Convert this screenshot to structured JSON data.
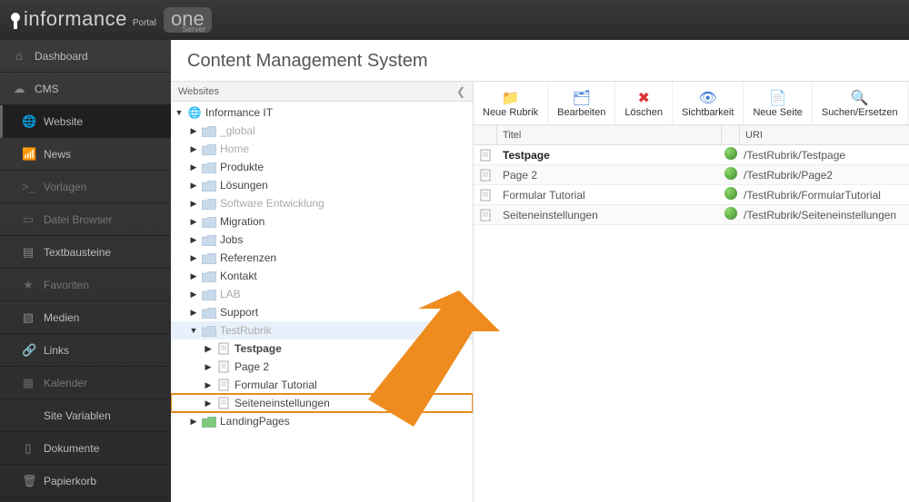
{
  "brand": {
    "name": "informance",
    "portal": "Portal",
    "one": "one",
    "server": "Server"
  },
  "sidebar": [
    {
      "icon": "home",
      "label": "Dashboard",
      "dim": false
    },
    {
      "icon": "cloud",
      "label": "CMS",
      "dim": false
    },
    {
      "icon": "globe",
      "label": "Website",
      "dim": false,
      "active": true,
      "indent": true
    },
    {
      "icon": "rss",
      "label": "News",
      "dim": false,
      "indent": true
    },
    {
      "icon": "code",
      "label": "Vorlagen",
      "dim": true,
      "indent": true
    },
    {
      "icon": "book",
      "label": "Datei Browser",
      "dim": true,
      "indent": true
    },
    {
      "icon": "text",
      "label": "Textbausteine",
      "dim": false,
      "indent": true
    },
    {
      "icon": "star",
      "label": "Favoriten",
      "dim": true,
      "indent": true
    },
    {
      "icon": "image",
      "label": "Medien",
      "dim": false,
      "indent": true
    },
    {
      "icon": "link",
      "label": "Links",
      "dim": false,
      "indent": true
    },
    {
      "icon": "cal",
      "label": "Kalender",
      "dim": true,
      "indent": true
    },
    {
      "icon": "vars",
      "label": "Site Variablen",
      "dim": false,
      "indent": true
    },
    {
      "icon": "doc",
      "label": "Dokumente",
      "dim": false,
      "indent": true
    },
    {
      "icon": "trash",
      "label": "Papierkorb",
      "dim": false,
      "indent": true
    }
  ],
  "page_title": "Content Management System",
  "tree_header": "Websites",
  "tree_root": "Informance IT",
  "tree": [
    {
      "lvl": 1,
      "type": "folder",
      "label": "_global",
      "dim": true
    },
    {
      "lvl": 1,
      "type": "folder",
      "label": "Home",
      "dim": true
    },
    {
      "lvl": 1,
      "type": "folder",
      "label": "Produkte"
    },
    {
      "lvl": 1,
      "type": "folder",
      "label": "Lösungen"
    },
    {
      "lvl": 1,
      "type": "folder",
      "label": "Software Entwicklung",
      "dim": true
    },
    {
      "lvl": 1,
      "type": "folder",
      "label": "Migration"
    },
    {
      "lvl": 1,
      "type": "folder",
      "label": "Jobs"
    },
    {
      "lvl": 1,
      "type": "folder",
      "label": "Referenzen"
    },
    {
      "lvl": 1,
      "type": "folder",
      "label": "Kontakt"
    },
    {
      "lvl": 1,
      "type": "folder",
      "label": "LAB",
      "dim": true
    },
    {
      "lvl": 1,
      "type": "folder",
      "label": "Support"
    },
    {
      "lvl": 1,
      "type": "folder",
      "label": "TestRubrik",
      "dim": true,
      "open": true,
      "selected": true
    },
    {
      "lvl": 2,
      "type": "page",
      "label": "Testpage",
      "bold": true
    },
    {
      "lvl": 2,
      "type": "page",
      "label": "Page 2"
    },
    {
      "lvl": 2,
      "type": "page",
      "label": "Formular Tutorial"
    },
    {
      "lvl": 2,
      "type": "page",
      "label": "Seiteneinstellungen",
      "highlight": true
    },
    {
      "lvl": 1,
      "type": "folder",
      "label": "LandingPages",
      "green": true
    }
  ],
  "toolbar": [
    {
      "icon": "new-folder",
      "label": "Neue Rubrik"
    },
    {
      "icon": "edit",
      "label": "Bearbeiten"
    },
    {
      "icon": "delete",
      "label": "Löschen"
    },
    {
      "icon": "visibility",
      "label": "Sichtbarkeit"
    },
    {
      "icon": "new-page",
      "label": "Neue Seite"
    },
    {
      "icon": "search-replace",
      "label": "Suchen/Ersetzen"
    }
  ],
  "grid_headers": {
    "title": "Titel",
    "uri": "URI"
  },
  "rows": [
    {
      "title": "Testpage",
      "uri": "/TestRubrik/Testpage",
      "bold": true
    },
    {
      "title": "Page 2",
      "uri": "/TestRubrik/Page2"
    },
    {
      "title": "Formular Tutorial",
      "uri": "/TestRubrik/FormularTutorial"
    },
    {
      "title": "Seiteneinstellungen",
      "uri": "/TestRubrik/Seiteneinstellungen"
    }
  ]
}
